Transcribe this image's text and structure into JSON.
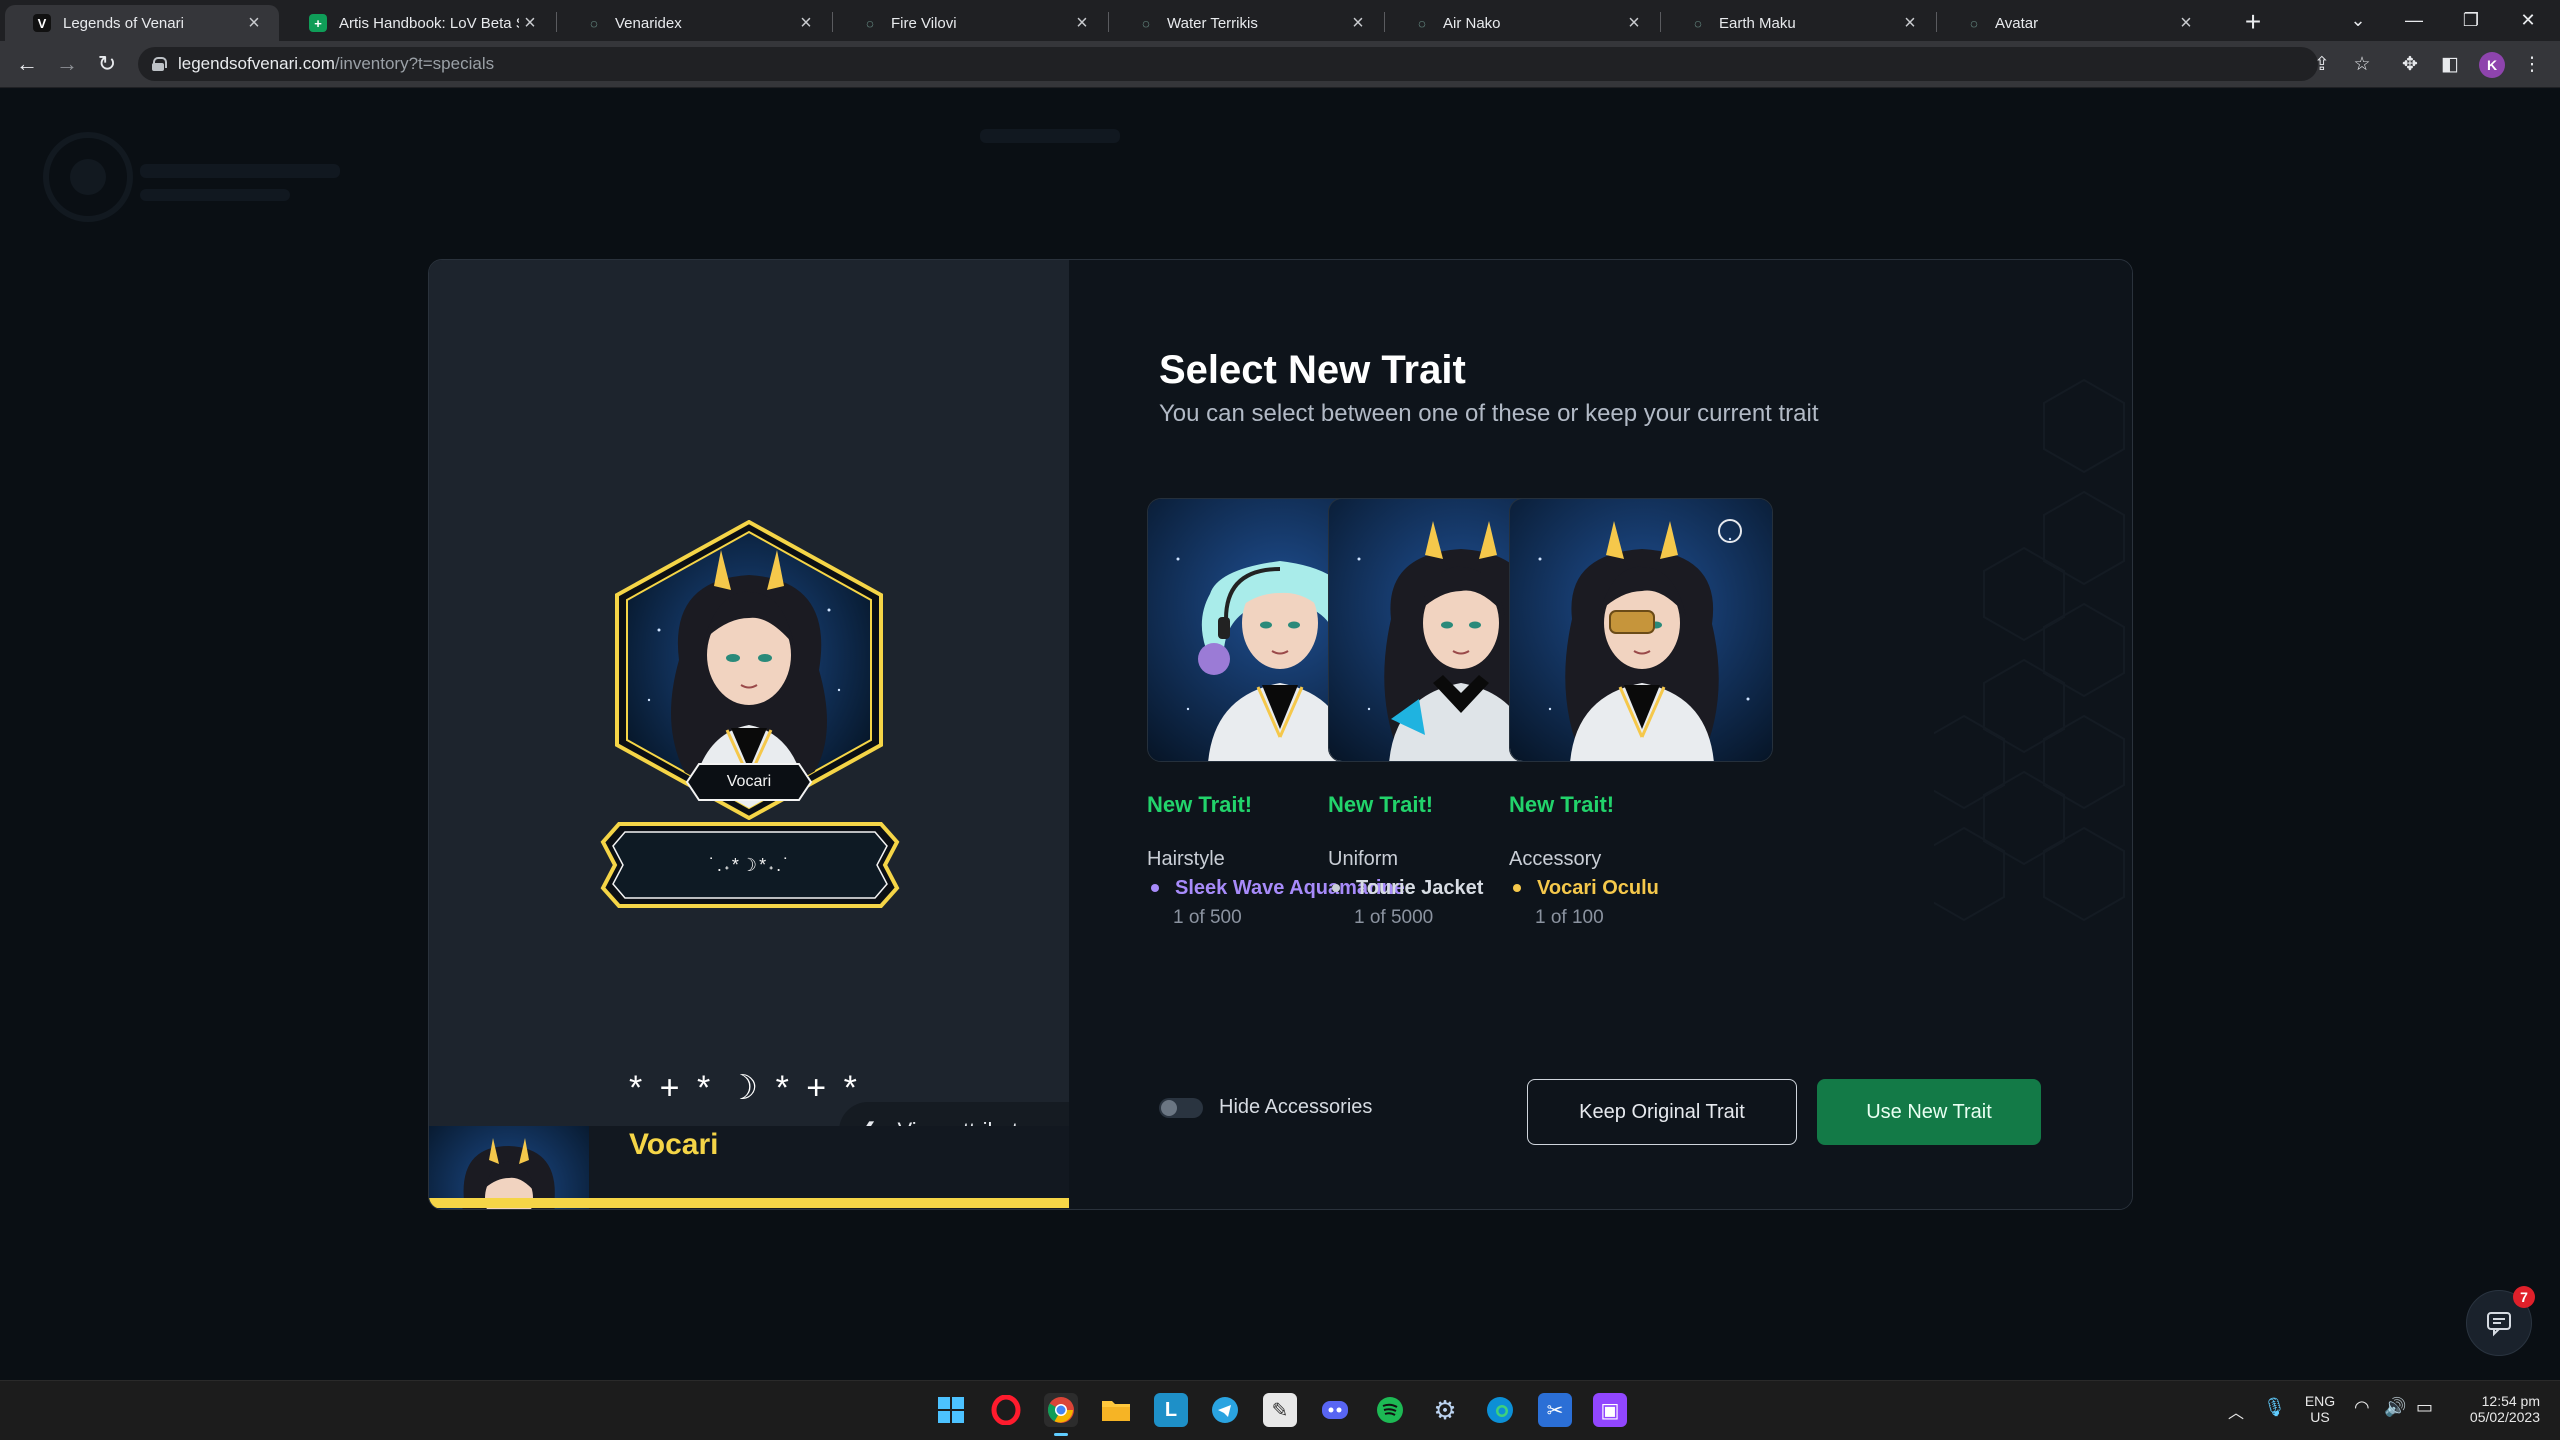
{
  "browser": {
    "tabs": [
      {
        "title": "Legends of Venari",
        "favicon": "V",
        "favicon_color": "#ffffff",
        "favicon_bg": "#111111",
        "active": true
      },
      {
        "title": "Artis Handbook: LoV Beta Sea",
        "favicon": "+",
        "favicon_color": "#ffffff",
        "favicon_bg": "#0f9d58",
        "active": false
      },
      {
        "title": "Venaridex",
        "favicon": "◌",
        "favicon_color": "#9ad8c9",
        "favicon_bg": "transparent",
        "active": false
      },
      {
        "title": "Fire Vilovi",
        "favicon": "◌",
        "favicon_color": "#9ad8c9",
        "favicon_bg": "transparent",
        "active": false
      },
      {
        "title": "Water Terrikis",
        "favicon": "◌",
        "favicon_color": "#9ad8c9",
        "favicon_bg": "transparent",
        "active": false
      },
      {
        "title": "Air Nako",
        "favicon": "◌",
        "favicon_color": "#9ad8c9",
        "favicon_bg": "transparent",
        "active": false
      },
      {
        "title": "Earth Maku",
        "favicon": "◌",
        "favicon_color": "#9ad8c9",
        "favicon_bg": "transparent",
        "active": false
      },
      {
        "title": "Avatar",
        "favicon": "◌",
        "favicon_color": "#9ad8c9",
        "favicon_bg": "transparent",
        "active": false
      }
    ],
    "url_host": "legendsofvenari.com",
    "url_path": "/inventory?t=specials",
    "profile_initial": "K"
  },
  "modal": {
    "heading": "Select New Trait",
    "subheading": "You can select between one of these or keep your current trait",
    "character": {
      "name_tag": "Vocari",
      "plaque_symbol": "˙.˖*☽*˖.˙",
      "footer_symbol": "* + * ☽ * + *",
      "footer_name": "Vocari"
    },
    "view_attributes_label": "View attributes",
    "options": [
      {
        "badge": "New Trait!",
        "category": "Hairstyle",
        "trait": "Sleek Wave Aquamarine",
        "trait_color": "#a78bfa",
        "dot_color": "#a78bfa",
        "rarity": "1 of 500",
        "hair": "#a9ecea"
      },
      {
        "badge": "New Trait!",
        "category": "Uniform",
        "trait": "Tourie Jacket",
        "trait_color": "#d7dce3",
        "dot_color": "#c9ced6",
        "rarity": "1 of 5000",
        "hair": "#1b1b22"
      },
      {
        "badge": "New Trait!",
        "category": "Accessory",
        "trait": "Vocari Oculu",
        "trait_color": "#f5c84b",
        "dot_color": "#f5c84b",
        "rarity": "1 of 100",
        "hair": "#1b1b22"
      }
    ],
    "hide_accessories_label": "Hide Accessories",
    "hide_accessories_on": false,
    "keep_button": "Keep Original Trait",
    "use_button": "Use New Trait"
  },
  "chat": {
    "badge_count": "7"
  },
  "taskbar": {
    "apps": [
      "windows-start",
      "opera",
      "chrome",
      "file-explorer",
      "l-app",
      "telegram",
      "paint",
      "discord",
      "spotify",
      "settings",
      "edge",
      "snipping-tool",
      "twitch"
    ],
    "lang_top": "ENG",
    "lang_bottom": "US",
    "time": "12:54 pm",
    "date": "05/02/2023"
  },
  "colors": {
    "accent_gold": "#f5d547",
    "new_trait_green": "#22d36b",
    "use_button_green": "#137a47"
  }
}
